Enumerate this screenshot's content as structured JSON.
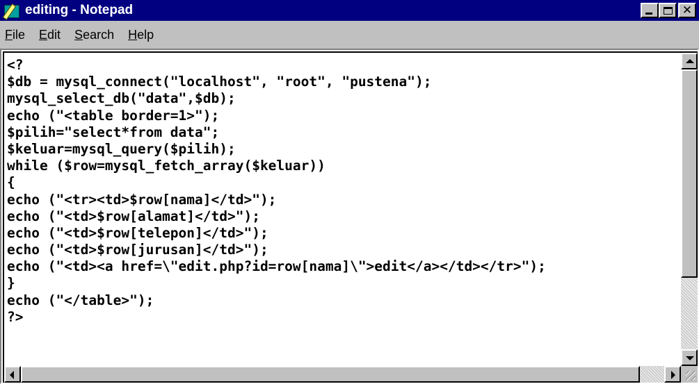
{
  "window": {
    "title": "editing - Notepad",
    "title_bar_color": "#000080"
  },
  "menu": [
    {
      "label": "File",
      "accel": "F",
      "rest": "ile"
    },
    {
      "label": "Edit",
      "accel": "E",
      "rest": "dit"
    },
    {
      "label": "Search",
      "accel": "S",
      "rest": "earch"
    },
    {
      "label": "Help",
      "accel": "H",
      "rest": "elp"
    }
  ],
  "editor": {
    "lines": [
      "<?",
      "$db = mysql_connect(\"localhost\", \"root\", \"pustena\");",
      "mysql_select_db(\"data\",$db);",
      "echo (\"<table border=1>\");",
      "$pilih=\"select*from data\";",
      "$keluar=mysql_query($pilih);",
      "while ($row=mysql_fetch_array($keluar))",
      "{",
      "echo (\"<tr><td>$row[nama]</td>\");",
      "echo (\"<td>$row[alamat]</td>\");",
      "echo (\"<td>$row[telepon]</td>\");",
      "echo (\"<td>$row[jurusan]</td>\");",
      "echo (\"<td><a href=\\\"edit.php?id=row[nama]\\\">edit</a></td></tr>\");",
      "}",
      "echo (\"</table>\");",
      "?>"
    ]
  },
  "icons": {
    "app": "notepad-icon",
    "minimize": "minimize-icon",
    "maximize": "maximize-icon",
    "close": "close-icon"
  }
}
